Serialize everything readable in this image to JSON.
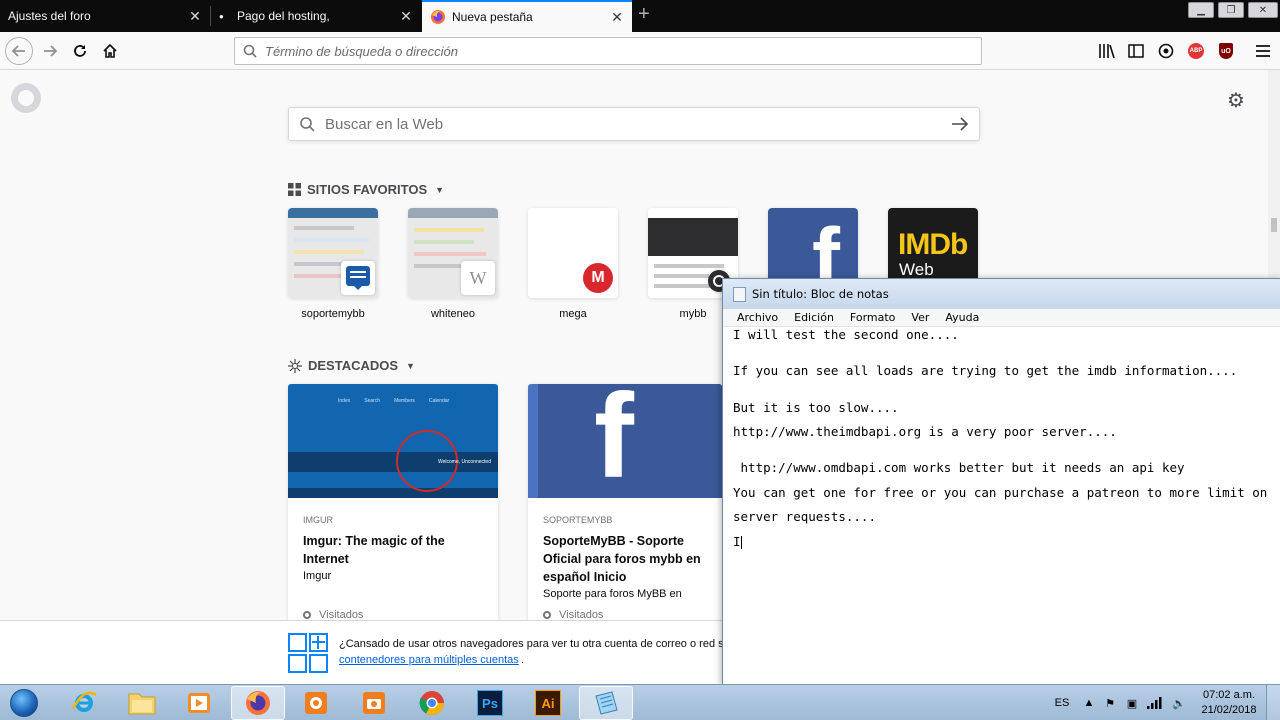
{
  "browser": {
    "tabs": [
      {
        "title": "Ajustes del foro",
        "active": false
      },
      {
        "title": "Pago del hosting,",
        "active": false
      },
      {
        "title": "Nueva pestaña",
        "active": true
      }
    ],
    "url_placeholder": "Término de búsqueda o dirección",
    "window_title_fragment": "2"
  },
  "newtab": {
    "search_placeholder": "Buscar en la Web",
    "top_sites_title": "SITIOS FAVORITOS",
    "top_sites": [
      {
        "label": "soportemybb"
      },
      {
        "label": "whiteneo",
        "badge": "W"
      },
      {
        "label": "mega",
        "badge": "M"
      },
      {
        "label": "mybb"
      },
      {
        "label": "",
        "logo": "f"
      },
      {
        "label": "",
        "logo_line1": "IMDb",
        "logo_line2": "Web"
      }
    ],
    "highlights_title": "DESTACADOS",
    "highlights": [
      {
        "source": "IMGUR",
        "title": "Imgur: The magic of the Internet",
        "description": "Imgur",
        "visited": "Visitados",
        "nav": [
          "Index",
          "Search",
          "Members",
          "Calendar"
        ],
        "welcome": "Welcome, Unconnected"
      },
      {
        "source": "SOPORTEMYBB",
        "title": "SoporteMyBB - Soporte Oficial para foros mybb en español Inicio",
        "description": "Soporte para foros MyBB en",
        "visited": "Visitados"
      }
    ],
    "bottom_message": "¿Cansado de usar otros navegadores para ver tu otra cuenta de correo o red so",
    "bottom_link": "contenedores para múltiples cuentas",
    "bottom_link_end": "."
  },
  "notepad": {
    "title": "Sin título: Bloc de notas",
    "menu": [
      "Archivo",
      "Edición",
      "Formato",
      "Ver",
      "Ayuda"
    ],
    "lines": [
      "I will test the second one....",
      "If you can see all loads are trying to get the imdb information....",
      "But it is too slow....",
      "http://www.theimdbapi.org is a very poor server....",
      " http://www.omdbapi.com works better but it needs an api key",
      "You can get one for free or you can purchase a patreon to more limit on",
      "server requests....",
      "I"
    ]
  },
  "taskbar": {
    "language": "ES",
    "time": "07:02 a.m.",
    "date": "21/02/2018",
    "apps": [
      "internet-explorer",
      "file-explorer",
      "media-player",
      "firefox",
      "app-orange",
      "camera-app",
      "chrome",
      "photoshop",
      "illustrator",
      "notepad"
    ],
    "ps_label": "Ps",
    "ai_label": "Ai"
  },
  "colors": {
    "accent": "#0a84ff",
    "tabstrip": "#0c0c0d",
    "facebook": "#3b5998",
    "imdb_yellow": "#f5c518"
  }
}
